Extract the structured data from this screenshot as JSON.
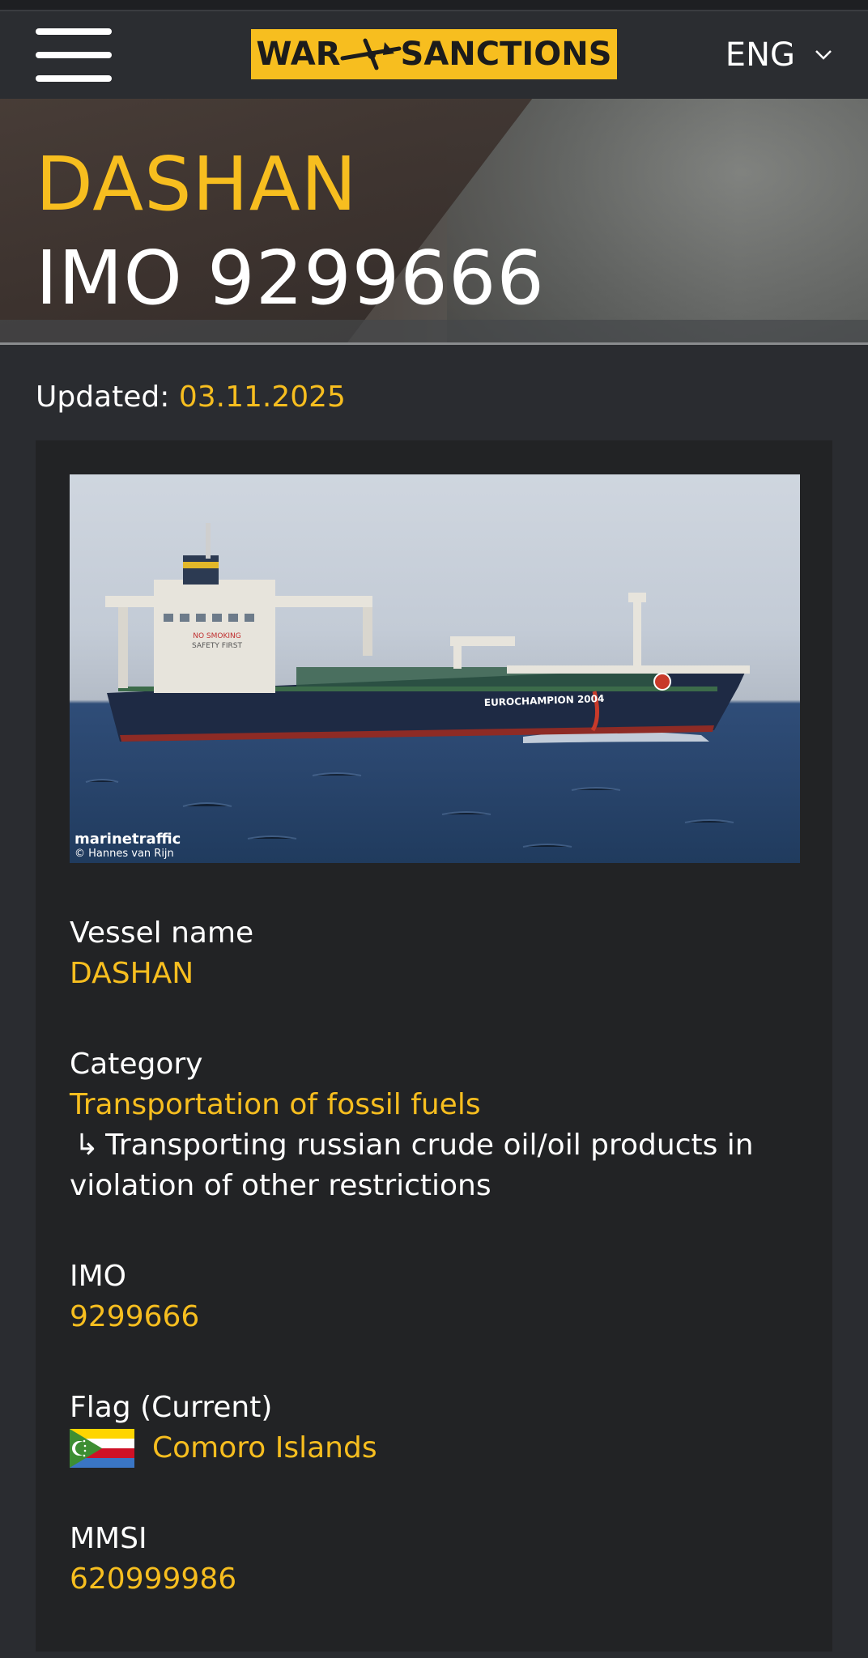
{
  "header": {
    "logo_text_left": "WAR",
    "logo_text_right": "SANCTIONS",
    "language": "ENG"
  },
  "hero": {
    "vessel_name": "DASHAN",
    "imo_line": "IMO 9299666"
  },
  "updated": {
    "label": "Updated:",
    "date": "03.11.2025"
  },
  "photo": {
    "brand": "marinetraffic",
    "author": "© Hannes van Rijn",
    "ship_text": "EUROCHAMPION 2004",
    "bridge_text_1": "NO SMOKING",
    "bridge_text_2": "SAFETY FIRST"
  },
  "fields": {
    "vessel_name": {
      "label": "Vessel name",
      "value": "DASHAN"
    },
    "category": {
      "label": "Category",
      "value": "Transportation of fossil fuels",
      "sub_arrow": "↳",
      "sub": "Transporting russian crude oil/oil products in violation of other restrictions"
    },
    "imo": {
      "label": "IMO",
      "value": "9299666"
    },
    "flag": {
      "label": "Flag (Current)",
      "value": "Comoro Islands",
      "flag_icon": "comoros-flag-icon"
    },
    "mmsi": {
      "label": "MMSI",
      "value": "620999986"
    }
  },
  "colors": {
    "accent": "#f7be1f",
    "background": "#2a2c30",
    "card": "#222325"
  }
}
